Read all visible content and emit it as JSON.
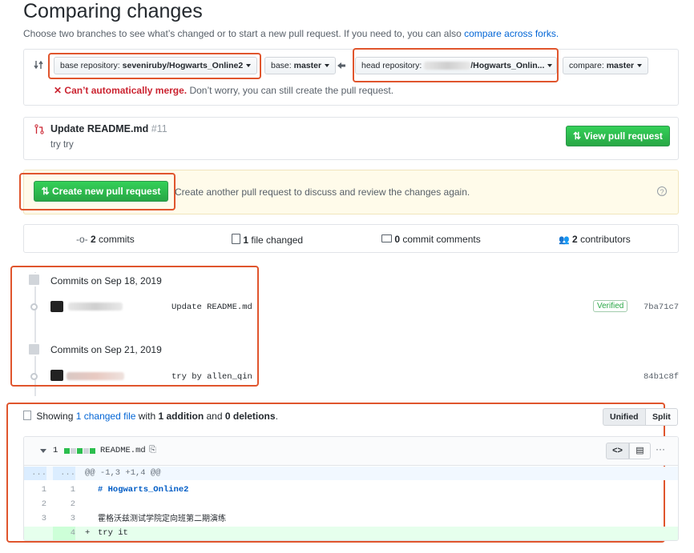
{
  "header": {
    "title": "Comparing changes",
    "subtitle": "Choose two branches to see what’s changed or to start a new pull request. If you need to, you can also",
    "subtitle_link": "compare across forks."
  },
  "range": {
    "base_repo_label": "base repository:",
    "base_repo_value": "seveniruby/Hogwarts_Online2",
    "base_label": "base:",
    "base_value": "master",
    "head_repo_label": "head repository:",
    "head_repo_value": "/Hogwarts_Onlin...",
    "compare_label": "compare:",
    "compare_value": "master",
    "merge_status": "Can’t automatically merge.",
    "merge_hint": "Don’t worry, you can still create the pull request."
  },
  "existing_pr": {
    "title": "Update README.md",
    "number": "#11",
    "description": "try try",
    "view_button": "View pull request"
  },
  "create_pr": {
    "button": "Create new pull request",
    "note": "Create another pull request to discuss and review the changes again."
  },
  "stats": {
    "commits_count": "2",
    "commits_label": "commits",
    "files_count": "1",
    "files_label": "file changed",
    "comments_count": "0",
    "comments_label": "commit comments",
    "contributors_count": "2",
    "contributors_label": "contributors"
  },
  "commit_groups": [
    {
      "date": "Commits on Sep 18, 2019",
      "commit": {
        "message": "Update README.md",
        "badge": "Verified",
        "sha": "7ba71c7"
      }
    },
    {
      "date": "Commits on Sep 21, 2019",
      "commit": {
        "message": "try by allen_qin",
        "sha": "84b1c8f"
      }
    }
  ],
  "diff": {
    "summary_prefix": "Showing",
    "summary_link": "1 changed file",
    "summary_mid": "with",
    "additions": "1 addition",
    "summary_and": "and",
    "deletions": "0 deletions",
    "summary_end": ".",
    "unified": "Unified",
    "split": "Split",
    "file_count": "1",
    "file_name": "README.md",
    "hunk_dots": "...",
    "hunk": "@@ -1,3 +1,4 @@",
    "lines": [
      {
        "old": "1",
        "new": "1",
        "sign": "",
        "text": "# Hogwarts_Online2"
      },
      {
        "old": "2",
        "new": "2",
        "sign": "",
        "text": ""
      },
      {
        "old": "3",
        "new": "3",
        "sign": "",
        "text": "霍格沃兹测试学院定向班第二期演练"
      },
      {
        "old": "",
        "new": "4",
        "sign": "+",
        "text": "try it"
      }
    ]
  },
  "colors": {
    "accent": "#0366d6",
    "green": "#28a745",
    "annotation": "#e0552d",
    "error": "#cb2431"
  }
}
